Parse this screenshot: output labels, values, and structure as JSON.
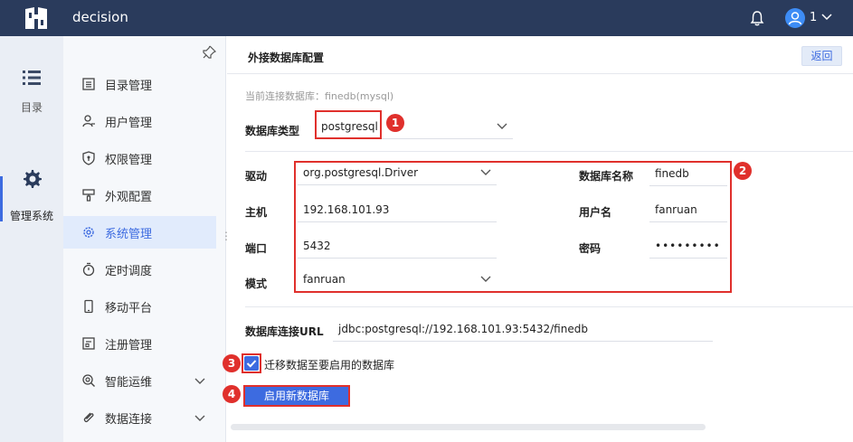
{
  "app": {
    "title": "decision",
    "user": "1"
  },
  "rail": {
    "items": [
      {
        "label": "目录",
        "icon": "list-icon"
      },
      {
        "label": "管理系统",
        "icon": "gear-icon"
      }
    ]
  },
  "sidebar": {
    "items": [
      {
        "label": "目录管理",
        "icon": "catalog-icon"
      },
      {
        "label": "用户管理",
        "icon": "user-icon"
      },
      {
        "label": "权限管理",
        "icon": "shield-icon"
      },
      {
        "label": "外观配置",
        "icon": "paint-icon"
      },
      {
        "label": "系统管理",
        "icon": "gear-icon"
      },
      {
        "label": "定时调度",
        "icon": "timer-icon"
      },
      {
        "label": "移动平台",
        "icon": "mobile-icon"
      },
      {
        "label": "注册管理",
        "icon": "register-icon"
      },
      {
        "label": "智能运维",
        "icon": "ops-icon"
      },
      {
        "label": "数据连接",
        "icon": "link-icon"
      }
    ]
  },
  "main": {
    "title": "外接数据库配置",
    "back_label": "返回",
    "current_db": "当前连接数据库：finedb(mysql)",
    "db_type_label": "数据库类型",
    "db_type_value": "postgresql",
    "driver_label": "驱动",
    "driver_value": "org.postgresql.Driver",
    "host_label": "主机",
    "host_value": "192.168.101.93",
    "port_label": "端口",
    "port_value": "5432",
    "schema_label": "模式",
    "schema_value": "fanruan",
    "dbname_label": "数据库名称",
    "dbname_value": "finedb",
    "username_label": "用户名",
    "username_value": "fanruan",
    "password_label": "密码",
    "password_value": "•••••••••",
    "url_label": "数据库连接URL",
    "url_value": "jdbc:postgresql://192.168.101.93:5432/finedb",
    "migrate_label": "迁移数据至要启用的数据库",
    "migrate_checked": true,
    "enable_label": "启用新数据库"
  },
  "badges": [
    "1",
    "2",
    "3",
    "4"
  ],
  "colors": {
    "topbar": "#2a3b5c",
    "accent": "#3d6be0",
    "annotation": "#e0302c"
  }
}
